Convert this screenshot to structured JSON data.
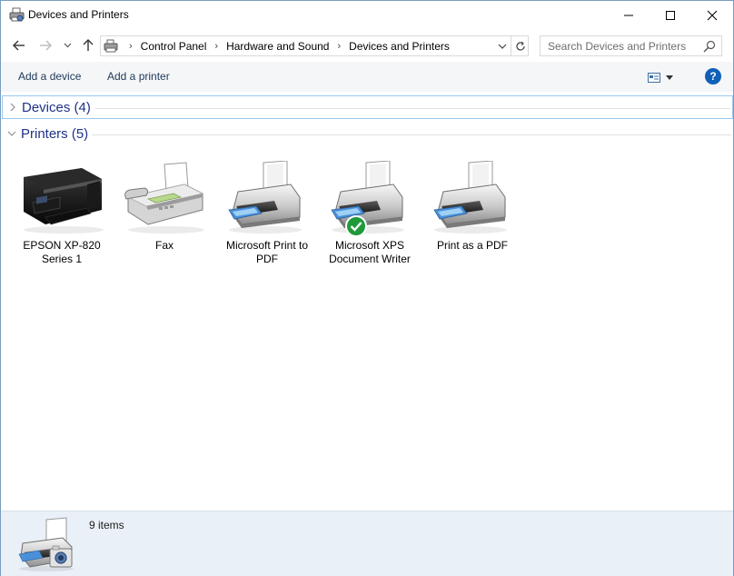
{
  "window": {
    "title": "Devices and Printers",
    "controls": [
      "minimize",
      "maximize",
      "close"
    ]
  },
  "navigation": {
    "back_icon": "arrow-left-icon",
    "forward_icon": "arrow-right-icon",
    "recent_icon": "chevron-down-icon",
    "up_icon": "arrow-up-icon",
    "breadcrumbs": [
      "Control Panel",
      "Hardware and Sound",
      "Devices and Printers"
    ],
    "refresh_icon": "refresh-icon"
  },
  "search": {
    "placeholder": "Search Devices and Printers",
    "value": ""
  },
  "toolbar": {
    "add_device": "Add a device",
    "add_printer": "Add a printer",
    "help": "?"
  },
  "groups": {
    "devices": {
      "title": "Devices (4)",
      "expanded": false
    },
    "printers": {
      "title": "Printers (5)",
      "expanded": true
    }
  },
  "printers": [
    {
      "name": "EPSON XP-820\nSeries 1",
      "icon": "epson-printer-icon",
      "default": false
    },
    {
      "name": "Fax",
      "icon": "fax-machine-icon",
      "default": false
    },
    {
      "name": "Microsoft Print to\nPDF",
      "icon": "printer-icon",
      "default": false
    },
    {
      "name": "Microsoft XPS\nDocument Writer",
      "icon": "printer-icon",
      "default": true
    },
    {
      "name": "Print as a PDF",
      "icon": "printer-icon",
      "default": false
    }
  ],
  "status": {
    "count": "9 items"
  },
  "colors": {
    "group_title": "#1e3287",
    "command_text": "#1e395b",
    "status_bg": "#eaf0f7",
    "help_blue": "#1160b8",
    "default_check": "#1f9a3a"
  }
}
